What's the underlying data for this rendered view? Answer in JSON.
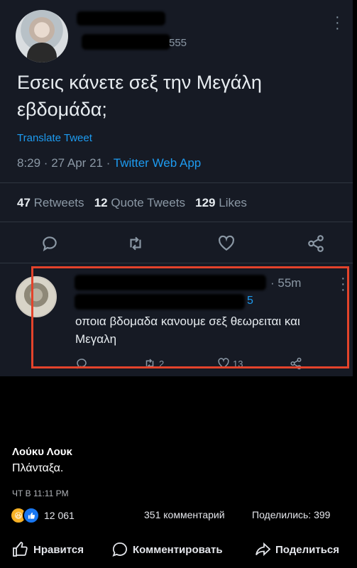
{
  "tweet": {
    "handle_partial": "555",
    "text": "Εσεις κάνετε σεξ την Μεγάλη εβδομάδα;",
    "translate_label": "Translate Tweet",
    "time_date": "8:29 · 27 Apr 21 · ",
    "source": "Twitter Web App",
    "stats": {
      "retweets_count": "47",
      "retweets_label": "Retweets",
      "quotes_count": "12",
      "quotes_label": "Quote Tweets",
      "likes_count": "129",
      "likes_label": "Likes"
    },
    "icons": [
      "reply-icon",
      "retweet-icon",
      "like-icon",
      "share-icon"
    ]
  },
  "reply": {
    "time": "· 55m",
    "partial": "5",
    "text": "οποια βδομαδα κανουμε σεξ θεωρειται και Μεγαλη",
    "retweets": "2",
    "likes": "13",
    "highlight_color": "#e3432b"
  },
  "post": {
    "author": "Λούκυ Λουκ",
    "text": "Πλάνταξα.",
    "time": "ЧТ В 11:11 PM",
    "reactions_count": "12 061",
    "comments": "351 комментарий",
    "shares": "Поделились: 399"
  },
  "actions": {
    "like": "Нравится",
    "comment": "Комментировать",
    "share": "Поделиться"
  }
}
